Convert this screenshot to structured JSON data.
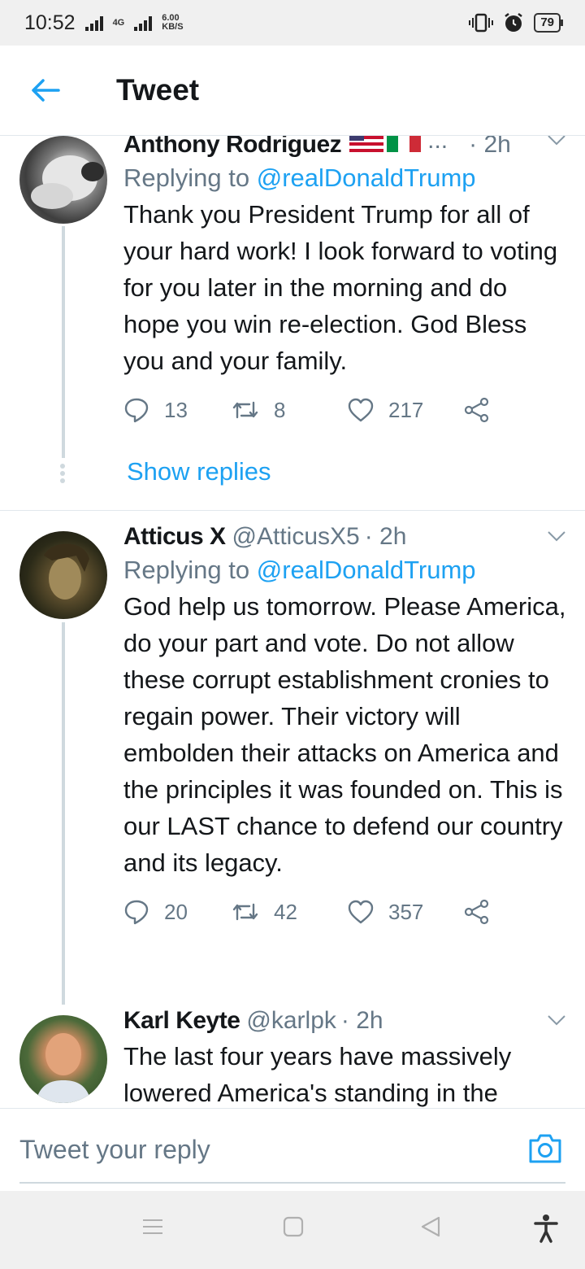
{
  "status_bar": {
    "time": "10:52",
    "network_type": "4G",
    "speed_value": "6.00",
    "speed_unit": "KB/S",
    "battery": "79"
  },
  "header": {
    "title": "Tweet"
  },
  "tweets": [
    {
      "name": "Anthony Rodriguez",
      "handle": "",
      "name_suffix": "...",
      "time": "· 2h",
      "reply_prefix": "Replying to ",
      "reply_target": "@realDonaldTrump",
      "text": "Thank you President Trump for all of your hard work! I look forward to voting for you later in the morning and do hope you win re-election. God Bless you and your family.",
      "replies": "13",
      "retweets": "8",
      "likes": "217",
      "show_replies": "Show replies"
    },
    {
      "name": "Atticus X",
      "handle": "@AtticusX5",
      "time": "· 2h",
      "reply_prefix": "Replying to ",
      "reply_target": "@realDonaldTrump",
      "text": "God help us tomorrow. Please America, do your part and vote. Do not allow these corrupt establishment cronies to regain power. Their victory will embolden their attacks on America and the principles it was founded on. This is our LAST chance to defend our country and its legacy.",
      "replies": "20",
      "retweets": "42",
      "likes": "357"
    },
    {
      "name": "Karl Keyte",
      "handle": "@karlpk",
      "time": "· 2h",
      "text": "The last four years have massively lowered America's standing in the"
    }
  ],
  "reply_bar": {
    "placeholder": "Tweet your reply"
  },
  "colors": {
    "accent": "#1da1f2",
    "secondary_text": "#657786",
    "divider": "#e1e8ed"
  }
}
